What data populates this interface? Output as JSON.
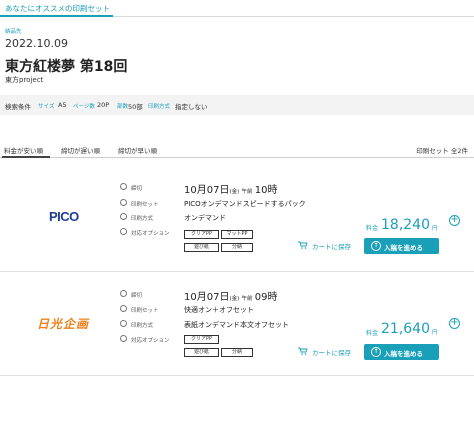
{
  "header": {
    "tab_label": "あなたにオススメの印刷セット"
  },
  "event": {
    "date_label": "納品先",
    "date": "2022.10.09",
    "title": "東方紅楼夢 第18回",
    "circle": "東方project"
  },
  "conditions": {
    "label": "検索条件",
    "size_key": "サイズ",
    "size_val": "A5",
    "pages_key": "ページ数",
    "pages_val": "20P",
    "copies_key": "部数",
    "copies_val": "50部",
    "method_key": "印刷方式",
    "method_val": "指定しない"
  },
  "sort": {
    "tabs": [
      "料金が安い順",
      "締切が遅い順",
      "締切が早い順"
    ],
    "count": "印刷セット 全2件"
  },
  "row_labels": {
    "deadline": "締切",
    "set": "印刷セット",
    "method": "印刷方式",
    "option": "対応オプション"
  },
  "cards": [
    {
      "logo": "PICO",
      "deadline_main": "10月07日",
      "deadline_day": "(金)",
      "deadline_ampm": "午前",
      "deadline_time": "10時",
      "set_name": "PICOオンデマンドスピードするパック",
      "method": "オンデマンド",
      "options": [
        "クリアPP",
        "マットPP",
        "遊び紙",
        "分納"
      ],
      "price_label": "料金",
      "price": "18,240",
      "yen": "円",
      "cart_label": "カートに保存",
      "submit_label": "入稿を進める"
    },
    {
      "logo": "日光企画",
      "deadline_main": "10月07日",
      "deadline_day": "(金)",
      "deadline_ampm": "午前",
      "deadline_time": "09時",
      "set_name": "快適オン＋オフセット",
      "method": "表紙オンデマンド本文オフセット",
      "options": [
        "クリアPP",
        "遊び紙",
        "分納"
      ],
      "price_label": "料金",
      "price": "21,640",
      "yen": "円",
      "cart_label": "カートに保存",
      "submit_label": "入稿を進める"
    }
  ],
  "colors": {
    "accent": "#19a0b8",
    "pico_blue": "#1f3e94",
    "nikko_orange": "#ef7f1a"
  },
  "icons": [
    "clock-icon",
    "printer-icon",
    "document-icon",
    "tag-icon",
    "plus-icon",
    "cart-icon",
    "upload-icon"
  ]
}
